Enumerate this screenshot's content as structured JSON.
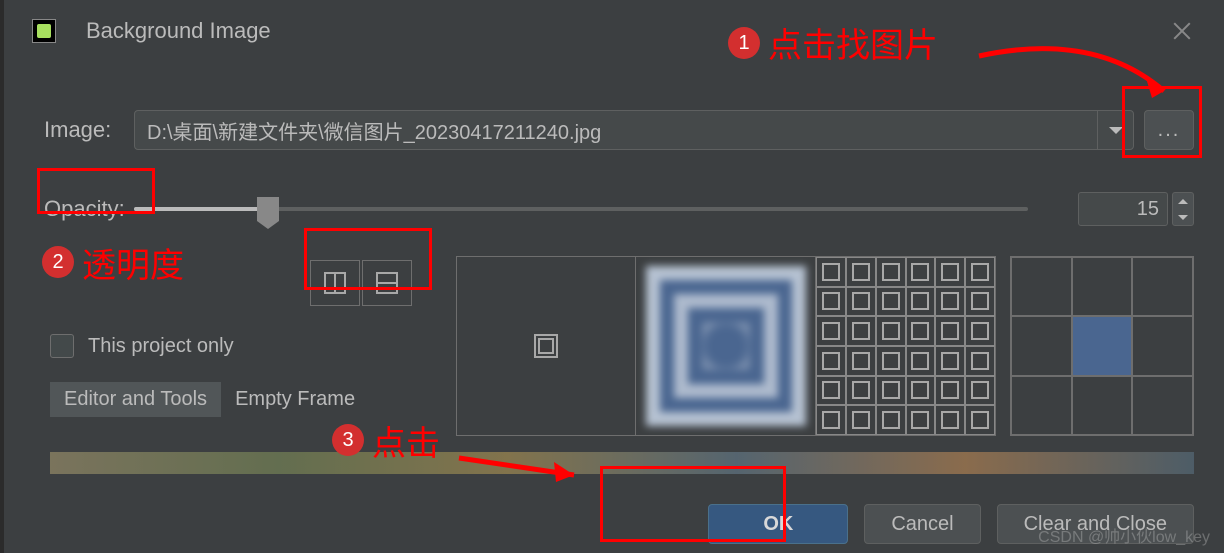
{
  "window": {
    "title": "Background Image"
  },
  "image_row": {
    "label": "Image:",
    "path": "D:\\桌面\\新建文件夹\\微信图片_20230417211240.jpg",
    "browse": "..."
  },
  "opacity_row": {
    "label": "Opacity:",
    "value": "15"
  },
  "options": {
    "checkbox_label": "This project only",
    "tabs": [
      "Editor and Tools",
      "Empty Frame"
    ],
    "active_tab": 0
  },
  "buttons": {
    "ok": "OK",
    "cancel": "Cancel",
    "clear": "Clear and Close"
  },
  "annotations": {
    "hint1": "点击找图片",
    "hint2": "透明度",
    "hint3": "点击"
  },
  "watermark": "CSDN @帅小伙low_key"
}
